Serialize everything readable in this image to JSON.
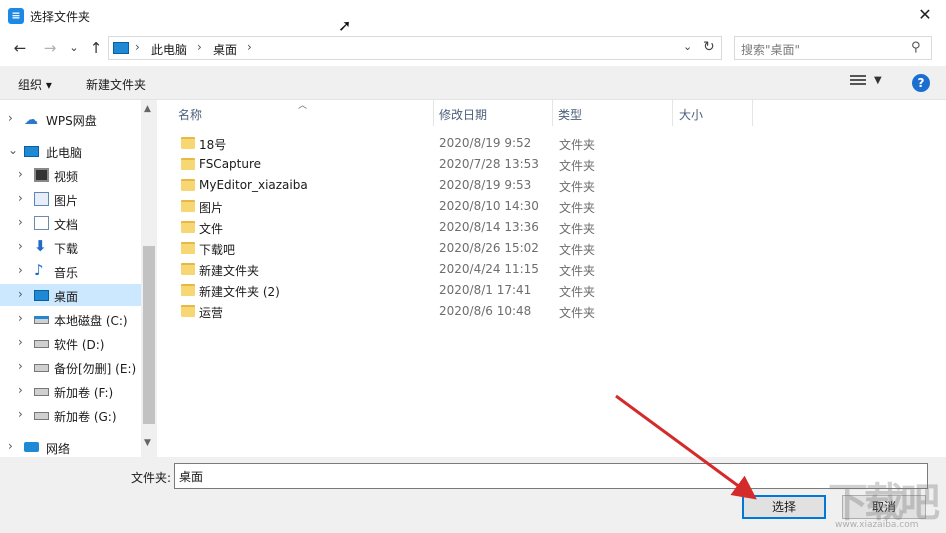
{
  "window": {
    "title": "选择文件夹",
    "close": "✕"
  },
  "nav": {
    "back": "←",
    "forward": "→",
    "recent": "⌄",
    "up": "↑"
  },
  "address": {
    "segments": [
      "此电脑",
      "桌面"
    ],
    "separator": "›"
  },
  "search": {
    "placeholder": "搜索\"桌面\""
  },
  "toolbar": {
    "organize": "组织 ▾",
    "new_folder": "新建文件夹",
    "help": "?"
  },
  "tree": [
    {
      "label": "WPS网盘",
      "icon": "cloud-icon",
      "chev": "›",
      "level": 0
    },
    {
      "label": "此电脑",
      "icon": "pc-icon",
      "chev": "⌄",
      "level": 0
    },
    {
      "label": "视频",
      "icon": "video-icon",
      "chev": "›",
      "level": 1
    },
    {
      "label": "图片",
      "icon": "picture-icon",
      "chev": "›",
      "level": 1
    },
    {
      "label": "文档",
      "icon": "document-icon",
      "chev": "›",
      "level": 1
    },
    {
      "label": "下载",
      "icon": "download-icon",
      "chev": "›",
      "level": 1
    },
    {
      "label": "音乐",
      "icon": "music-icon",
      "chev": "›",
      "level": 1
    },
    {
      "label": "桌面",
      "icon": "desktop-icon",
      "chev": "›",
      "level": 1,
      "selected": true
    },
    {
      "label": "本地磁盘 (C:)",
      "icon": "drive-c-icon",
      "chev": "›",
      "level": 1
    },
    {
      "label": "软件 (D:)",
      "icon": "drive-icon",
      "chev": "›",
      "level": 1
    },
    {
      "label": "备份[勿删] (E:)",
      "icon": "drive-icon",
      "chev": "›",
      "level": 1
    },
    {
      "label": "新加卷 (F:)",
      "icon": "drive-icon",
      "chev": "›",
      "level": 1
    },
    {
      "label": "新加卷 (G:)",
      "icon": "drive-icon",
      "chev": "›",
      "level": 1
    },
    {
      "label": "网络",
      "icon": "network-icon",
      "chev": "›",
      "level": 0
    }
  ],
  "columns": {
    "name": "名称",
    "date": "修改日期",
    "type": "类型",
    "size": "大小"
  },
  "files": [
    {
      "name": "18号",
      "date": "2020/8/19 9:52",
      "type": "文件夹"
    },
    {
      "name": "FSCapture",
      "date": "2020/7/28 13:53",
      "type": "文件夹"
    },
    {
      "name": "MyEditor_xiazaiba",
      "date": "2020/8/19 9:53",
      "type": "文件夹"
    },
    {
      "name": "图片",
      "date": "2020/8/10 14:30",
      "type": "文件夹"
    },
    {
      "name": "文件",
      "date": "2020/8/14 13:36",
      "type": "文件夹"
    },
    {
      "name": "下载吧",
      "date": "2020/8/26 15:02",
      "type": "文件夹"
    },
    {
      "name": "新建文件夹",
      "date": "2020/4/24 11:15",
      "type": "文件夹"
    },
    {
      "name": "新建文件夹 (2)",
      "date": "2020/8/1 17:41",
      "type": "文件夹"
    },
    {
      "name": "运营",
      "date": "2020/8/6 10:48",
      "type": "文件夹"
    }
  ],
  "bottom": {
    "folder_label": "文件夹:",
    "folder_value": "桌面",
    "select_button": "选择",
    "cancel_button": "取消"
  },
  "watermark": {
    "text": "下载吧",
    "url": "www.xiazaiba.com"
  },
  "colors": {
    "accent": "#0078d7",
    "selection": "#cce8ff",
    "folder": "#f7d674",
    "annotation_arrow": "#d42a2a"
  }
}
